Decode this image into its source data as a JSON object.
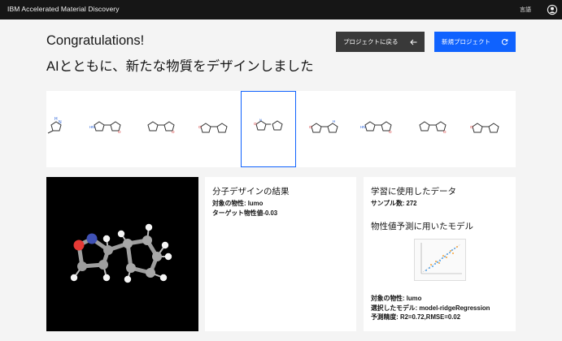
{
  "header": {
    "app_title": "IBM Accelerated Material Discovery",
    "language_label": "言語",
    "user_icon": "user-avatar-icon"
  },
  "hero": {
    "title": "Congratulations!",
    "subtitle": "AIとともに、新たな物質をデザインしました"
  },
  "actions": {
    "back_label": "プロジェクトに戻る",
    "back_icon": "arrow-left-icon",
    "new_label": "新規プロジェクト",
    "new_icon": "refresh-icon"
  },
  "carousel": {
    "selected_index": 4,
    "molecules": [
      "molecule-1",
      "molecule-2",
      "molecule-3",
      "molecule-4",
      "molecule-5",
      "molecule-6",
      "molecule-7",
      "molecule-8",
      "molecule-9"
    ]
  },
  "design_result": {
    "title": "分子デザインの結果",
    "property_line": "対象の物性: lumo",
    "target_line": "ターゲット物性値-0.03"
  },
  "training": {
    "title": "学習に使用したデータ",
    "sample_line": "サンプル数: 272",
    "model_title": "物性値予測に用いたモデル",
    "property_line": "対象の物性: lumo",
    "model_line": "選択したモデル: model-ridgeRegression",
    "accuracy_line": "予測精度: R2=0.72,RMSE=0.02"
  },
  "colors": {
    "topbar": "#161616",
    "primary": "#0f62fe",
    "secondary": "#393939",
    "background": "#f4f4f4"
  }
}
